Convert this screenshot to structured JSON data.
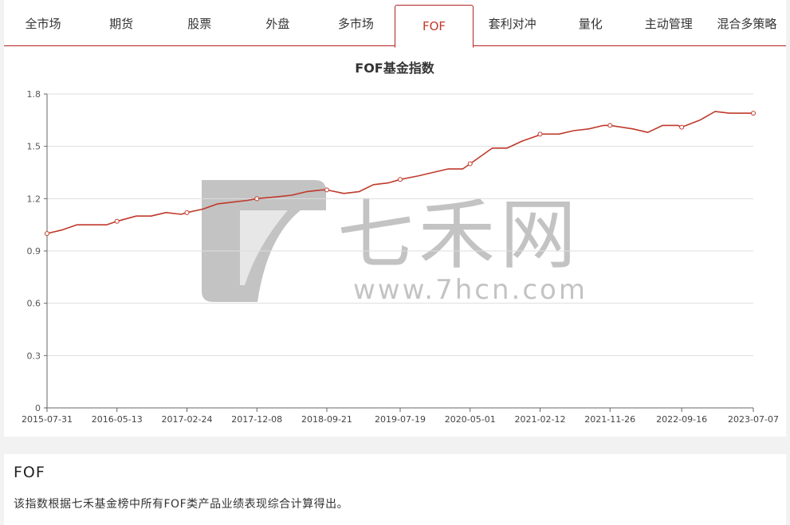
{
  "tabs": [
    {
      "label": "全市场",
      "active": false
    },
    {
      "label": "期货",
      "active": false
    },
    {
      "label": "股票",
      "active": false
    },
    {
      "label": "外盘",
      "active": false
    },
    {
      "label": "多市场",
      "active": false
    },
    {
      "label": "FOF",
      "active": true
    },
    {
      "label": "套利对冲",
      "active": false
    },
    {
      "label": "量化",
      "active": false
    },
    {
      "label": "主动管理",
      "active": false
    },
    {
      "label": "混合多策略",
      "active": false
    }
  ],
  "colors": {
    "accent": "#b22222",
    "line": "#c0392b",
    "grid": "#dddddd",
    "watermark": "#bdbdbd"
  },
  "watermark": {
    "brand": "七禾网",
    "url": "www.7hcn.com"
  },
  "chart_data": {
    "type": "line",
    "title": "FOF基金指数",
    "ylim": [
      0,
      1.8
    ],
    "yticks": [
      "0",
      "0.3",
      "0.6",
      "0.9",
      "1.2",
      "1.5",
      "1.8"
    ],
    "ytick_values": [
      0,
      0.3,
      0.6,
      0.9,
      1.2,
      1.5,
      1.8
    ],
    "xticks": [
      "2015-07-31",
      "2016-05-13",
      "2017-02-24",
      "2017-12-08",
      "2018-09-21",
      "2019-07-19",
      "2020-05-01",
      "2021-02-12",
      "2021-11-26",
      "2022-09-16",
      "2023-07-07"
    ],
    "grid": true,
    "series": [
      {
        "x": [
          "2015-07-31",
          "2015-09-30",
          "2015-11-30",
          "2016-01-31",
          "2016-03-31",
          "2016-05-13",
          "2016-07-31",
          "2016-09-30",
          "2016-11-30",
          "2017-01-31",
          "2017-02-24",
          "2017-04-30",
          "2017-06-30",
          "2017-08-31",
          "2017-10-31",
          "2017-12-08",
          "2018-02-28",
          "2018-04-30",
          "2018-06-30",
          "2018-08-31",
          "2018-09-21",
          "2018-11-30",
          "2019-01-31",
          "2019-03-31",
          "2019-05-31",
          "2019-07-19",
          "2019-09-30",
          "2019-11-30",
          "2020-01-31",
          "2020-03-31",
          "2020-05-01",
          "2020-07-31",
          "2020-09-30",
          "2020-11-30",
          "2021-01-31",
          "2021-02-12",
          "2021-04-30",
          "2021-06-30",
          "2021-08-31",
          "2021-10-31",
          "2021-11-26",
          "2022-02-28",
          "2022-04-30",
          "2022-06-30",
          "2022-08-31",
          "2022-09-16",
          "2022-11-30",
          "2023-01-31",
          "2023-03-31",
          "2023-05-31",
          "2023-07-07"
        ],
        "values": [
          1.0,
          1.02,
          1.05,
          1.05,
          1.05,
          1.07,
          1.1,
          1.1,
          1.12,
          1.11,
          1.12,
          1.14,
          1.17,
          1.18,
          1.19,
          1.2,
          1.21,
          1.22,
          1.24,
          1.25,
          1.25,
          1.23,
          1.24,
          1.28,
          1.29,
          1.31,
          1.33,
          1.35,
          1.37,
          1.37,
          1.4,
          1.49,
          1.49,
          1.53,
          1.56,
          1.57,
          1.57,
          1.59,
          1.6,
          1.62,
          1.62,
          1.6,
          1.58,
          1.62,
          1.62,
          1.61,
          1.65,
          1.7,
          1.69,
          1.69,
          1.69
        ]
      }
    ]
  },
  "info": {
    "title": "FOF",
    "description": "该指数根据七禾基金榜中所有FOF类产品业绩表现综合计算得出。"
  }
}
